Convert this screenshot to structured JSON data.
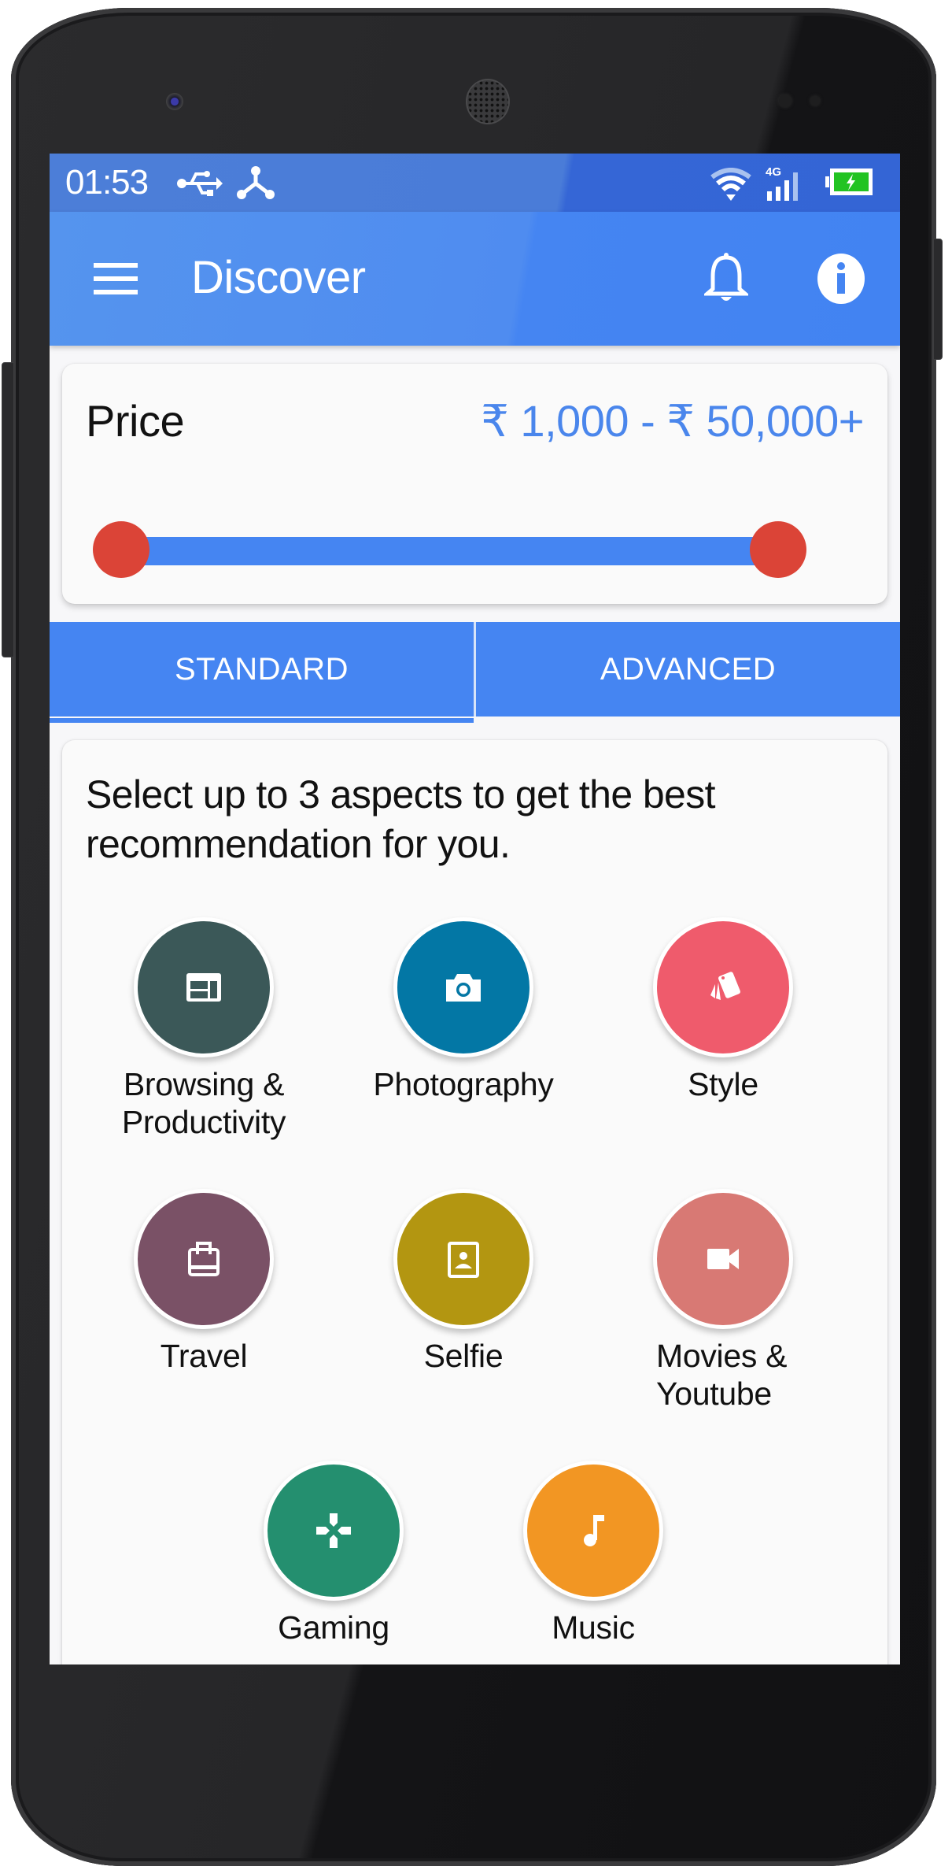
{
  "status_bar": {
    "time": "01:53",
    "icons": [
      "usb-icon",
      "share-icon",
      "wifi-icon",
      "signal-4g-icon",
      "battery-charging-icon"
    ],
    "network_label": "4G"
  },
  "app_bar": {
    "title": "Discover",
    "left_icon": "menu-icon",
    "right_icons": [
      "bell-icon",
      "info-icon"
    ]
  },
  "price_filter": {
    "label": "Price",
    "range_text": "₹ 1,000 - ₹ 50,000+",
    "min_value": 1000,
    "max_value": 50000,
    "selected_min": 1000,
    "selected_max": 50000,
    "selected_min_fraction": 0.0,
    "selected_max_fraction": 1.0,
    "track_color": "#4585f2",
    "thumb_color": "#db4437"
  },
  "tabs": [
    {
      "label": "STANDARD",
      "active": true
    },
    {
      "label": "ADVANCED",
      "active": false
    }
  ],
  "aspects": {
    "prompt": "Select up to 3 aspects to get the best recommendation for you.",
    "items": [
      {
        "label": "Browsing & Productivity",
        "line1": "Browsing &",
        "line2": "Productivity",
        "icon": "browser-window-icon",
        "color": "#3b5858"
      },
      {
        "label": "Photography",
        "line1": "Photography",
        "line2": "",
        "icon": "camera-icon",
        "color": "#0377a5"
      },
      {
        "label": "Style",
        "line1": "Style",
        "line2": "",
        "icon": "swatch-cards-icon",
        "color": "#ef5b6c"
      },
      {
        "label": "Travel",
        "line1": "Travel",
        "line2": "",
        "icon": "luggage-bag-icon",
        "color": "#7a5166"
      },
      {
        "label": "Selfie",
        "line1": "Selfie",
        "line2": "",
        "icon": "portrait-icon",
        "color": "#b39611"
      },
      {
        "label": "Movies & Youtube",
        "line1": "Movies &",
        "line2": "Youtube",
        "icon": "video-camera-icon",
        "color": "#d87974"
      },
      {
        "label": "Gaming",
        "line1": "Gaming",
        "line2": "",
        "icon": "gamepad-icon",
        "color": "#248f6f"
      },
      {
        "label": "Music",
        "line1": "Music",
        "line2": "",
        "icon": "music-note-icon",
        "color": "#f29623"
      }
    ]
  },
  "colors": {
    "primary": "#4585f2",
    "status_bar": "#3566d6",
    "accent_price": "#4a86ec",
    "background": "#f7f7f9"
  }
}
